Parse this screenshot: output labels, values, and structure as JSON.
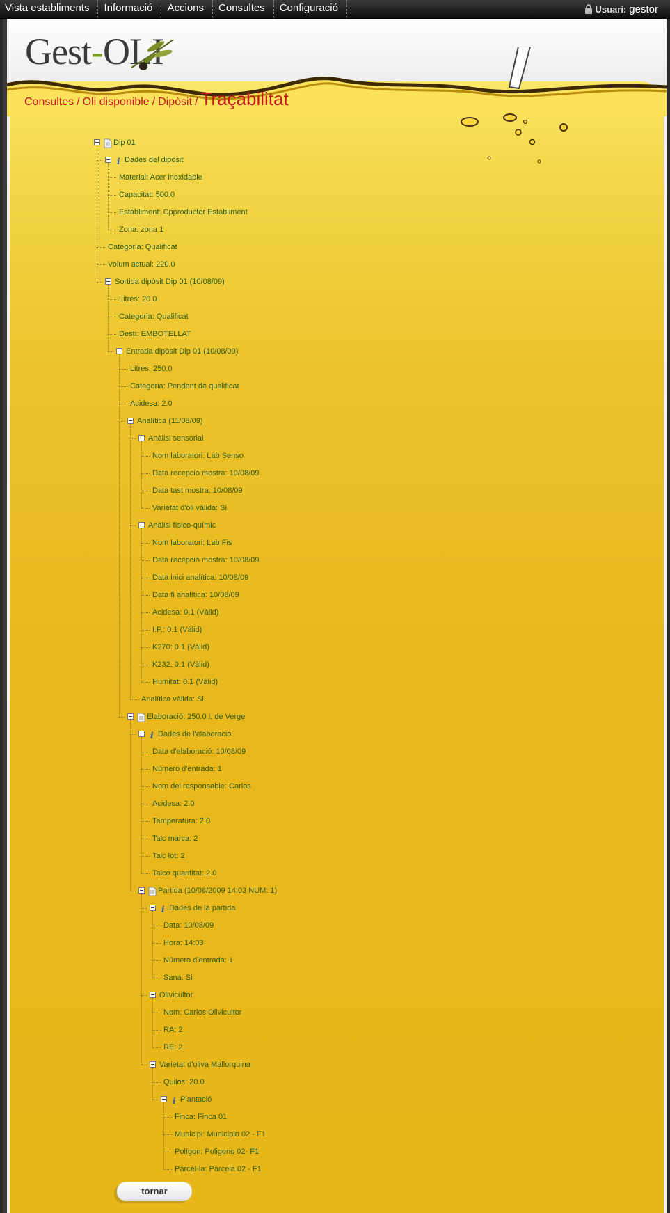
{
  "menu": {
    "items": [
      {
        "label": "Vista establiments"
      },
      {
        "label": "Informació"
      },
      {
        "label": "Accions"
      },
      {
        "label": "Consultes"
      },
      {
        "label": "Configuració"
      }
    ]
  },
  "user": {
    "label": "Usuari:",
    "name": "gestor",
    "icon": "lock-icon"
  },
  "logo": {
    "text_a": "Gest",
    "dash": "-",
    "text_b": "OLI"
  },
  "breadcrumb": {
    "items": [
      "Consultes",
      "Oli disponible",
      "Dipòsit"
    ],
    "separator": "/",
    "current": "Traçabilitat"
  },
  "tree": [
    {
      "text": "Dip 01",
      "level": 0,
      "toggle": true,
      "icon": "document-icon"
    },
    {
      "text": "Dades del dipòsit",
      "level": 1,
      "toggle": true,
      "icon": "info-icon"
    },
    {
      "text": "Material: Acer inoxidable",
      "level": 2
    },
    {
      "text": "Capacitat: 500.0",
      "level": 2
    },
    {
      "text": "Establiment: Cpproductor Establiment",
      "level": 2
    },
    {
      "text": "Zona: zona 1",
      "level": 2
    },
    {
      "text": "Categoria: Qualificat",
      "level": 1
    },
    {
      "text": "Volum actual: 220.0",
      "level": 1
    },
    {
      "text": "Sortida dipòsit Dip 01 (10/08/09)",
      "level": 1,
      "toggle": true
    },
    {
      "text": "Litres: 20.0",
      "level": 2
    },
    {
      "text": "Categoria: Qualificat",
      "level": 2
    },
    {
      "text": "Destí: EMBOTELLAT",
      "level": 2
    },
    {
      "text": "Entrada dipòsit Dip 01 (10/08/09)",
      "level": 2,
      "toggle": true
    },
    {
      "text": "Litres: 250.0",
      "level": 3
    },
    {
      "text": "Categoria: Pendent de qualificar",
      "level": 3
    },
    {
      "text": "Acidesa: 2.0",
      "level": 3
    },
    {
      "text": "Analítica (11/08/09)",
      "level": 3,
      "toggle": true
    },
    {
      "text": "Anàlisi sensorial",
      "level": 4,
      "toggle": true
    },
    {
      "text": "Nom laboratori: Lab Senso",
      "level": 5
    },
    {
      "text": "Data recepció mostra: 10/08/09",
      "level": 5
    },
    {
      "text": "Data tast mostra: 10/08/09",
      "level": 5
    },
    {
      "text": "Varietat d'oli vàlida: Si",
      "level": 5
    },
    {
      "text": "Anàlisi físico-químic",
      "level": 4,
      "toggle": true
    },
    {
      "text": "Nom laboratori: Lab Fis",
      "level": 5
    },
    {
      "text": "Data recepció mostra: 10/08/09",
      "level": 5
    },
    {
      "text": "Data inici analítica: 10/08/09",
      "level": 5
    },
    {
      "text": "Data fi analítica: 10/08/09",
      "level": 5
    },
    {
      "text": "Acidesa: 0.1 (Vàlid)",
      "level": 5
    },
    {
      "text": "I.P.: 0.1 (Vàlid)",
      "level": 5
    },
    {
      "text": "K270: 0.1 (Vàlid)",
      "level": 5
    },
    {
      "text": "K232: 0.1 (Vàlid)",
      "level": 5
    },
    {
      "text": "Humitat: 0.1 (Vàlid)",
      "level": 5
    },
    {
      "text": "Analítica vàlida: Si",
      "level": 4
    },
    {
      "text": "Elaboració: 250.0 l. de Verge",
      "level": 3,
      "toggle": true,
      "icon": "document-icon"
    },
    {
      "text": "Dades de l'elaboració",
      "level": 4,
      "toggle": true,
      "icon": "info-icon"
    },
    {
      "text": "Data d'elaboració: 10/08/09",
      "level": 5
    },
    {
      "text": "Número d'entrada: 1",
      "level": 5
    },
    {
      "text": "Nom del responsable: Carlos",
      "level": 5
    },
    {
      "text": "Acidesa: 2.0",
      "level": 5
    },
    {
      "text": "Temperatura: 2.0",
      "level": 5
    },
    {
      "text": "Talc marca: 2",
      "level": 5
    },
    {
      "text": "Talc lot: 2",
      "level": 5
    },
    {
      "text": "Talco quantitat: 2.0",
      "level": 5
    },
    {
      "text": "Partida (10/08/2009 14:03 NUM: 1)",
      "level": 4,
      "toggle": true,
      "icon": "document-icon"
    },
    {
      "text": "Dades de la partida",
      "level": 5,
      "toggle": true,
      "icon": "info-icon"
    },
    {
      "text": "Data: 10/08/09",
      "level": 6
    },
    {
      "text": "Hora: 14:03",
      "level": 6
    },
    {
      "text": "Número d'entrada: 1",
      "level": 6
    },
    {
      "text": "Sana: Si",
      "level": 6
    },
    {
      "text": "Olivicultor",
      "level": 5,
      "toggle": true
    },
    {
      "text": "Nom: Carlos Olivicultor",
      "level": 6
    },
    {
      "text": "RA: 2",
      "level": 6
    },
    {
      "text": "RE: 2",
      "level": 6
    },
    {
      "text": "Varietat d'oliva Mallorquina",
      "level": 5,
      "toggle": true
    },
    {
      "text": "Quilos: 20.0",
      "level": 6
    },
    {
      "text": "Plantació",
      "level": 6,
      "toggle": true,
      "icon": "info-icon"
    },
    {
      "text": "Finca: Finca 01",
      "level": 7
    },
    {
      "text": "Municipi: Municipio 02 - F1",
      "level": 7
    },
    {
      "text": "Polígon: Poligono 02- F1",
      "level": 7
    },
    {
      "text": "Parcel·la: Parcela 02 - F1",
      "level": 7
    }
  ],
  "buttons": {
    "back": "tornar"
  }
}
